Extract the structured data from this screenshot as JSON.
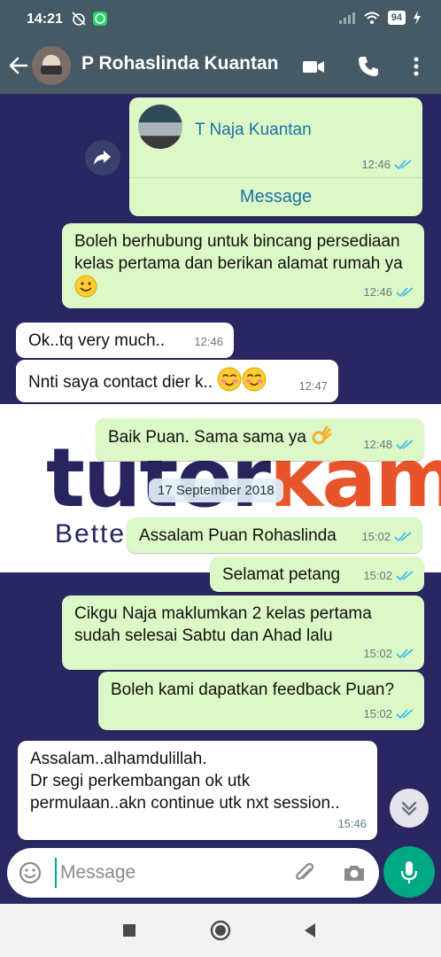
{
  "status_bar": {
    "time": "14:21",
    "battery": "94"
  },
  "header": {
    "contact_name": "P Rohaslinda Kuantan"
  },
  "contact_card": {
    "name": "T Naja Kuantan",
    "time": "12:46",
    "button_label": "Message"
  },
  "wallpaper": {
    "brand_part1": "tutor",
    "brand_part2": "kami",
    "tagline": "Bette"
  },
  "messages": [
    {
      "dir": "out",
      "text": "Boleh berhubung untuk bincang persediaan kelas pertama dan berikan alamat rumah ya",
      "time": "12:46"
    },
    {
      "dir": "in",
      "text": "Ok..tq very much..",
      "time": "12:46"
    },
    {
      "dir": "in",
      "text": "Nnti saya contact dier k..",
      "time": "12:47"
    },
    {
      "dir": "out",
      "text": "Baik Puan. Sama sama ya",
      "time": "12:48"
    },
    {
      "dir": "out",
      "text": "Assalam Puan Rohaslinda",
      "time": "15:02"
    },
    {
      "dir": "out",
      "text": "Selamat petang",
      "time": "15:02"
    },
    {
      "dir": "out",
      "text": "Cikgu Naja maklumkan 2 kelas pertama sudah selesai Sabtu dan Ahad lalu",
      "time": "15:02"
    },
    {
      "dir": "out",
      "text": "Boleh kami dapatkan feedback Puan?",
      "time": "15:02"
    },
    {
      "dir": "in",
      "text_lines": [
        "Assalam..alhamdulillah.",
        "Dr segi perkembangan ok utk",
        "permulaan..akn continue utk nxt session.."
      ],
      "time": "15:46"
    }
  ],
  "date_divider": "17 September 2018",
  "input": {
    "placeholder": "Message"
  },
  "colors": {
    "header": "#455a64",
    "outgoing": "#dcf8c6",
    "incoming": "#ffffff",
    "accent": "#00a884",
    "wallpaper": "#292661"
  }
}
